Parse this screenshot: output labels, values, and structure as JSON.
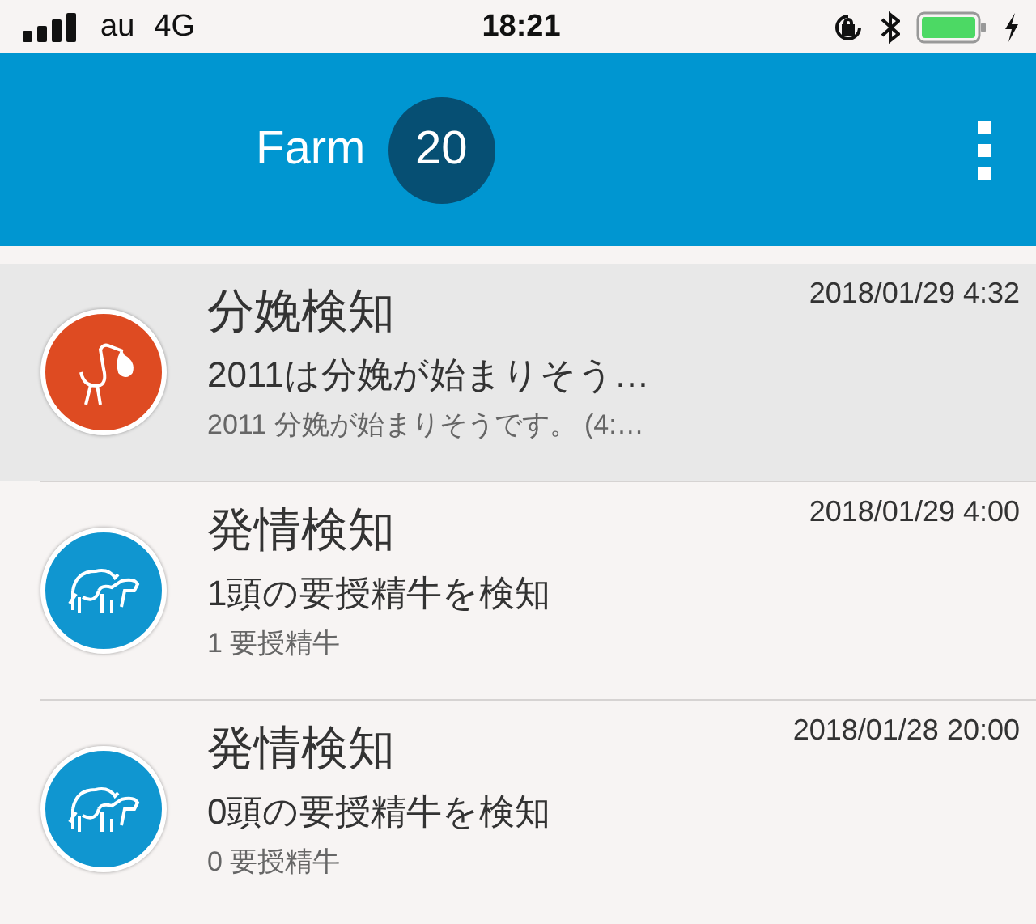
{
  "status_bar": {
    "carrier": "au",
    "network": "4G",
    "time": "18:21"
  },
  "header": {
    "title": "Farm",
    "count": "20"
  },
  "notifications": [
    {
      "kind": "calving",
      "color": "#de4b22",
      "selected": true,
      "title": "分娩検知",
      "date": "2018/01/29 4:32",
      "summary": "2011は分娩が始まりそう…",
      "detail": "2011 分娩が始まりそうです。 (4:…"
    },
    {
      "kind": "estrus",
      "color": "#1096d0",
      "selected": false,
      "title": "発情検知",
      "date": "2018/01/29 4:00",
      "summary": "1頭の要授精牛を検知",
      "detail": "1 要授精牛"
    },
    {
      "kind": "estrus",
      "color": "#1096d0",
      "selected": false,
      "title": "発情検知",
      "date": "2018/01/28 20:00",
      "summary": "0頭の要授精牛を検知",
      "detail": "0 要授精牛"
    }
  ]
}
